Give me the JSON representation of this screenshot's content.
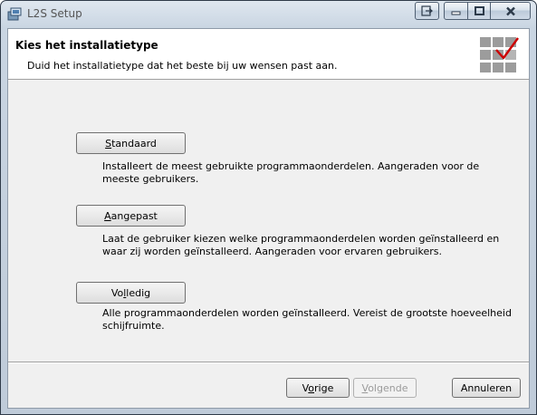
{
  "window": {
    "title": "L2S Setup",
    "icon": "setup-package-icon"
  },
  "caption_buttons": {
    "help": "help-arrow-icon",
    "minimize": "minimize-icon",
    "maximize": "maximize-icon",
    "close": "close-icon"
  },
  "header": {
    "title": "Kies het installatietype",
    "description": "Duid het installatietype dat het beste bij uw wensen past aan.",
    "banner_icon": "checkmark-grid-icon",
    "accent_color": "#cc0000"
  },
  "options": [
    {
      "mnemonic": "S",
      "label_rest": "tandaard",
      "description": "Installeert de meest gebruikte programmaonderdelen. Aangeraden voor de meeste gebruikers."
    },
    {
      "mnemonic": "A",
      "label_rest": "angepast",
      "description": "Laat de gebruiker kiezen welke programmaonderdelen worden geïnstalleerd en waar zij worden geïnstalleerd. Aangeraden voor ervaren gebruikers."
    },
    {
      "label_pre": "Vo",
      "mnemonic": "l",
      "label_rest": "ledig",
      "description": "Alle programmaonderdelen worden geïnstalleerd. Vereist de grootste hoeveelheid schijfruimte."
    }
  ],
  "footer": {
    "back": {
      "pre": "V",
      "mnemonic": "o",
      "rest": "rige"
    },
    "next": {
      "pre": "",
      "mnemonic": "V",
      "rest": "olgende"
    },
    "cancel": "Annuleren"
  }
}
